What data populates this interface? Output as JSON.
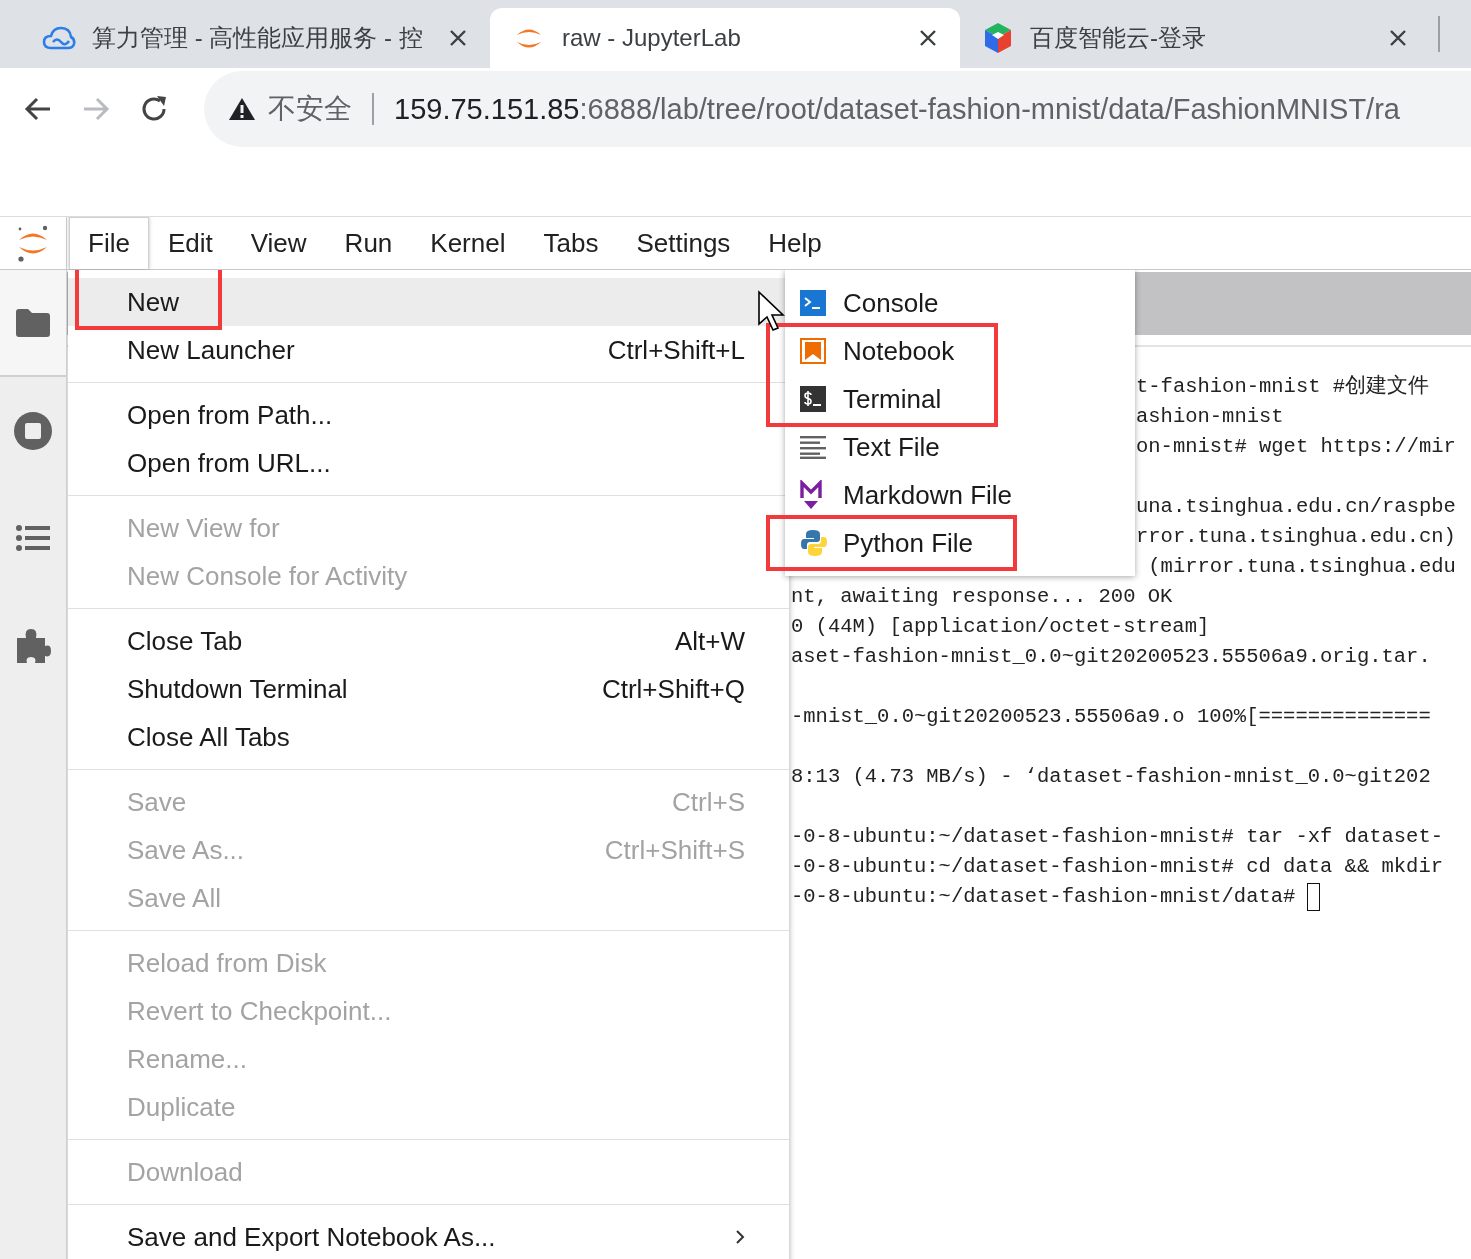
{
  "browser": {
    "tabs": [
      {
        "title": "算力管理 - 高性能应用服务 - 控",
        "kind": "cloud",
        "selected": false
      },
      {
        "title": "raw - JupyterLab",
        "kind": "jupyter",
        "selected": true
      },
      {
        "title": "百度智能云-登录",
        "kind": "cube",
        "selected": false
      }
    ],
    "nav": {
      "back": {
        "disabled": false
      },
      "forward": {
        "disabled": true
      }
    },
    "address": {
      "security": "不安全",
      "host": "159.75.151.85",
      "path": ":6888/lab/tree/root/dataset-fashion-mnist/data/FashionMNIST/ra"
    }
  },
  "menubar": [
    {
      "label": "File",
      "selected": true
    },
    {
      "label": "Edit",
      "selected": false
    },
    {
      "label": "View",
      "selected": false
    },
    {
      "label": "Run",
      "selected": false
    },
    {
      "label": "Kernel",
      "selected": false
    },
    {
      "label": "Tabs",
      "selected": false
    },
    {
      "label": "Settings",
      "selected": false
    },
    {
      "label": "Help",
      "selected": false
    }
  ],
  "file_menu": {
    "sections": [
      {
        "items": [
          {
            "label": "New",
            "selected": true,
            "disabled": false,
            "highlighted": true,
            "submenu_arrow": false
          },
          {
            "label": "New Launcher",
            "shortcut": "Ctrl+Shift+L",
            "selected": false,
            "disabled": false,
            "highlighted": false,
            "submenu_arrow": false
          }
        ]
      },
      {
        "items": [
          {
            "label": "Open from Path...",
            "selected": false,
            "disabled": false,
            "highlighted": false,
            "submenu_arrow": false
          },
          {
            "label": "Open from URL...",
            "selected": false,
            "disabled": false,
            "highlighted": false,
            "submenu_arrow": false
          }
        ]
      },
      {
        "items": [
          {
            "label": "New View for",
            "selected": false,
            "disabled": true,
            "highlighted": false,
            "submenu_arrow": false
          },
          {
            "label": "New Console for Activity",
            "selected": false,
            "disabled": true,
            "highlighted": false,
            "submenu_arrow": false
          }
        ]
      },
      {
        "items": [
          {
            "label": "Close Tab",
            "shortcut": "Alt+W",
            "selected": false,
            "disabled": false,
            "highlighted": false,
            "submenu_arrow": false
          },
          {
            "label": "Shutdown Terminal",
            "shortcut": "Ctrl+Shift+Q",
            "selected": false,
            "disabled": false,
            "highlighted": false,
            "submenu_arrow": false
          },
          {
            "label": "Close All Tabs",
            "selected": false,
            "disabled": false,
            "highlighted": false,
            "submenu_arrow": false
          }
        ]
      },
      {
        "items": [
          {
            "label": "Save",
            "shortcut": "Ctrl+S",
            "selected": false,
            "disabled": true,
            "highlighted": false,
            "submenu_arrow": false
          },
          {
            "label": "Save As...",
            "shortcut": "Ctrl+Shift+S",
            "selected": false,
            "disabled": true,
            "highlighted": false,
            "submenu_arrow": false
          },
          {
            "label": "Save All",
            "selected": false,
            "disabled": true,
            "highlighted": false,
            "submenu_arrow": false
          }
        ]
      },
      {
        "items": [
          {
            "label": "Reload from Disk",
            "selected": false,
            "disabled": true,
            "highlighted": false,
            "submenu_arrow": false
          },
          {
            "label": "Revert to Checkpoint...",
            "selected": false,
            "disabled": true,
            "highlighted": false,
            "submenu_arrow": false
          },
          {
            "label": "Rename...",
            "selected": false,
            "disabled": true,
            "highlighted": false,
            "submenu_arrow": false
          },
          {
            "label": "Duplicate",
            "selected": false,
            "disabled": true,
            "highlighted": false,
            "submenu_arrow": false
          }
        ]
      },
      {
        "items": [
          {
            "label": "Download",
            "selected": false,
            "disabled": true,
            "highlighted": false,
            "submenu_arrow": false
          }
        ]
      },
      {
        "items": [
          {
            "label": "Save and Export Notebook As...",
            "selected": false,
            "disabled": false,
            "highlighted": false,
            "submenu_arrow": true
          }
        ]
      }
    ]
  },
  "new_submenu": {
    "items": [
      {
        "label": "Console",
        "kind": "console",
        "highlighted": false
      },
      {
        "label": "Notebook",
        "kind": "notebook",
        "highlighted": true
      },
      {
        "label": "Terminal",
        "kind": "terminal",
        "highlighted": true
      },
      {
        "label": "Text File",
        "kind": "text",
        "highlighted": false
      },
      {
        "label": "Markdown File",
        "kind": "markdown",
        "highlighted": false
      },
      {
        "label": "Python File",
        "kind": "python",
        "highlighted": true
      }
    ]
  },
  "terminal": {
    "cursor": true,
    "lines": [
      {
        "kind": "covered",
        "text": "t-fashion-mnist #创建文件"
      },
      {
        "kind": "covered",
        "text": "ashion-mnist"
      },
      {
        "kind": "covered",
        "text": "on-mnist# wget https://mir"
      },
      {
        "kind": "blank"
      },
      {
        "kind": "covered",
        "text": "una.tsinghua.edu.cn/raspbe"
      },
      {
        "kind": "covered",
        "text": "rror.tuna.tsinghua.edu.cn)"
      },
      {
        "kind": "covered",
        "text": " (mirror.tuna.tsinghua.edu"
      },
      {
        "kind": "text",
        "text": "nt, awaiting response... 200 OK"
      },
      {
        "kind": "text",
        "text": "0 (44M) [application/octet-stream]"
      },
      {
        "kind": "text",
        "text": "aset-fashion-mnist_0.0~git20200523.55506a9.orig.tar."
      },
      {
        "kind": "blank"
      },
      {
        "kind": "text",
        "text": "-mnist_0.0~git20200523.55506a9.o 100%[=============="
      },
      {
        "kind": "blank"
      },
      {
        "kind": "text",
        "text": "8:13 (4.73 MB/s) - ‘dataset-fashion-mnist_0.0~git202"
      },
      {
        "kind": "blank"
      },
      {
        "kind": "text",
        "text": "-0-8-ubuntu:~/dataset-fashion-mnist# tar -xf dataset-"
      },
      {
        "kind": "text",
        "text": "-0-8-ubuntu:~/dataset-fashion-mnist# cd data && mkdir"
      },
      {
        "kind": "text",
        "text": "-0-8-ubuntu:~/dataset-fashion-mnist/data#"
      }
    ]
  }
}
